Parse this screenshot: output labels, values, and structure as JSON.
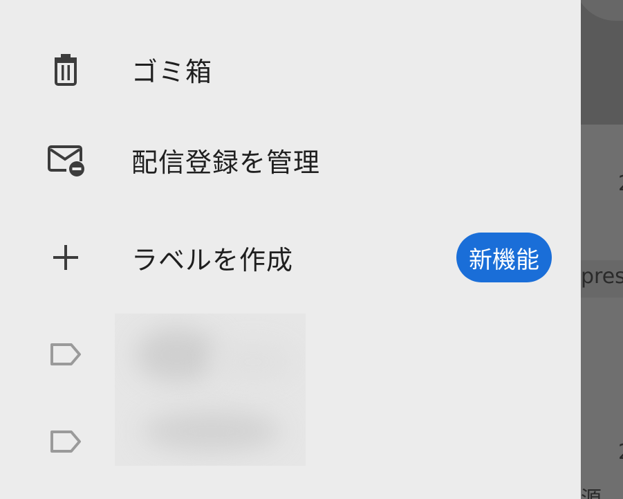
{
  "drawer": {
    "items": [
      {
        "label": "ゴミ箱",
        "icon": "trash-icon"
      },
      {
        "label": "配信登録を管理",
        "icon": "mail-unsubscribe-icon"
      },
      {
        "label": "ラベルを作成",
        "icon": "plus-icon",
        "badge": "新機能"
      }
    ],
    "labels": [
      {
        "icon": "label-icon",
        "name": ""
      },
      {
        "icon": "label-icon",
        "name": ""
      }
    ],
    "badge_color": "#1a6ed8",
    "background_color": "#ececec"
  },
  "background_app": {
    "visible_fragments": [
      "2",
      "pres",
      "2",
      "源"
    ]
  }
}
